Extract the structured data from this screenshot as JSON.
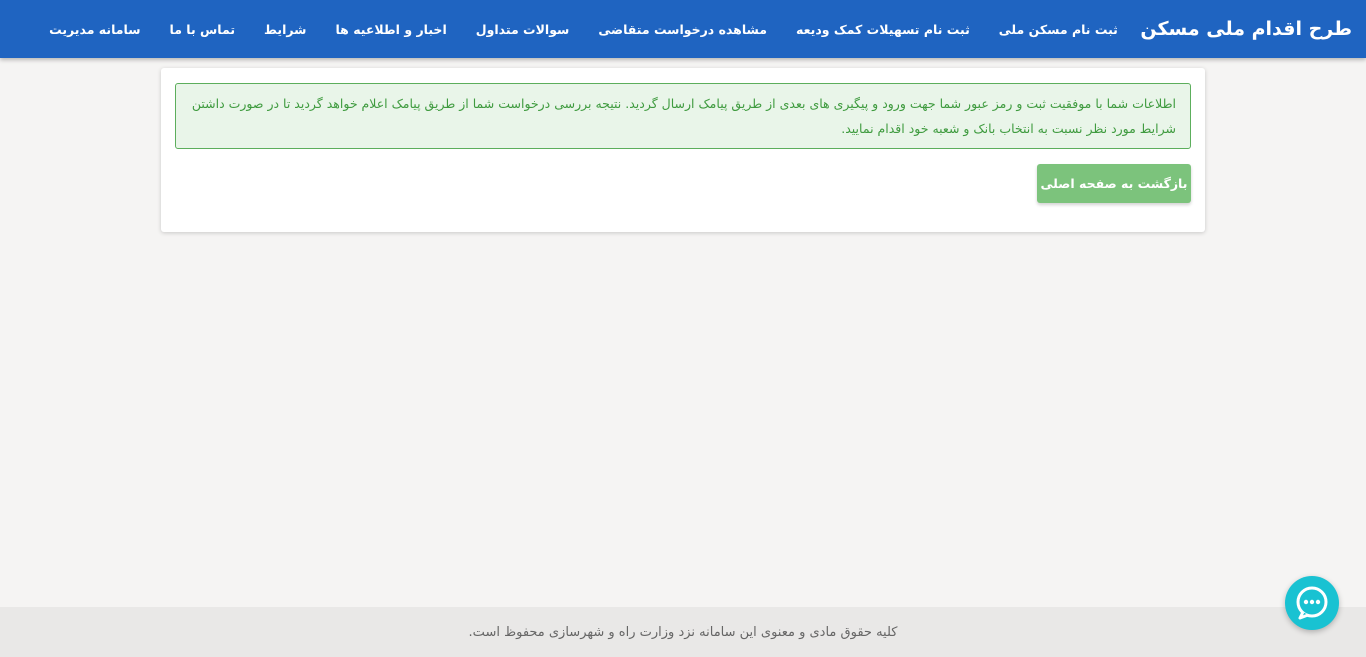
{
  "header": {
    "brand": "طرح اقدام ملی مسکن",
    "nav": [
      "ثبت نام مسکن ملی",
      "ثبت نام تسهیلات کمک ودیعه",
      "مشاهده درخواست متقاضی",
      "سوالات متداول",
      "اخبار و اطلاعیه ها",
      "شرایط",
      "تماس با ما",
      "سامانه مدیریت"
    ]
  },
  "main": {
    "alert_text": "اطلاعات شما با موفقیت ثبت و رمز عبور شما جهت ورود و پیگیری های بعدی از طریق پیامک ارسال گردید. نتیجه بررسی درخواست شما از طریق پیامک اعلام خواهد گردید تا در صورت داشتن شرایط مورد نظر نسبت به انتخاب بانک و شعبه خود اقدام نمایید.",
    "back_button_label": "بازگشت به صفحه اصلی"
  },
  "footer": {
    "text": "کلیه حقوق مادی و معنوی این سامانه نزد وزارت راه و شهرسازی محفوظ است."
  },
  "chat_widget": {
    "icon": "chat-bubble-icon"
  },
  "colors": {
    "header": "#1f64c1",
    "alert_bg": "#e9f5e9",
    "alert_text": "#3f9b3f",
    "button": "#7cc37c",
    "chat": "#19c2d2"
  }
}
